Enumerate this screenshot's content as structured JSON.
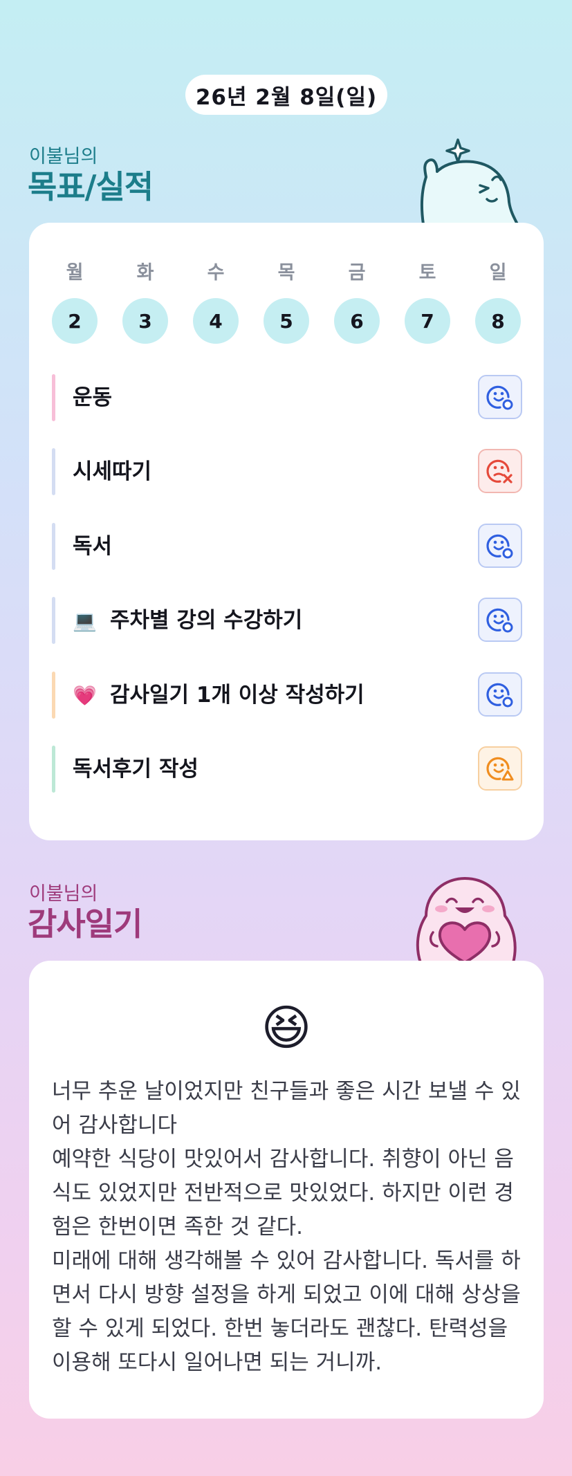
{
  "date": "26년 2월 8일(일)",
  "goals_section": {
    "subtitle": "이불님의",
    "title": "목표/실적",
    "days": [
      {
        "label": "월",
        "num": "2"
      },
      {
        "label": "화",
        "num": "3"
      },
      {
        "label": "수",
        "num": "4"
      },
      {
        "label": "목",
        "num": "5"
      },
      {
        "label": "금",
        "num": "6"
      },
      {
        "label": "토",
        "num": "7"
      },
      {
        "label": "일",
        "num": "8"
      }
    ],
    "goals": [
      {
        "emoji": "",
        "text": "운동",
        "bar_color": "#f7bfd8",
        "status": "done"
      },
      {
        "emoji": "",
        "text": "시세따기",
        "bar_color": "#d4ddf2",
        "status": "failed"
      },
      {
        "emoji": "",
        "text": "독서",
        "bar_color": "#d4ddf2",
        "status": "done"
      },
      {
        "emoji": "💻",
        "text": "주차별 강의 수강하기",
        "bar_color": "#d4ddf2",
        "status": "done"
      },
      {
        "emoji": "💗",
        "text": "감사일기 1개 이상 작성하기",
        "bar_color": "#fbd9b3",
        "status": "done"
      },
      {
        "emoji": "",
        "text": "독서후기 작성",
        "bar_color": "#bde8d6",
        "status": "partial"
      }
    ],
    "status_colors": {
      "done": "#2f5fe0",
      "failed": "#e5493a",
      "partial": "#f08d1f"
    }
  },
  "gratitude_section": {
    "subtitle": "이불님의",
    "title": "감사일기",
    "mood_emoji": "😆",
    "paragraphs": [
      "너무 추운 날이었지만 친구들과 좋은 시간 보낼 수 있어 감사합니다",
      "예약한 식당이 맛있어서 감사합니다. 취향이 아닌 음식도 있었지만 전반적으로 맛있었다. 하지만 이런 경험은 한번이면 족한 것 같다.",
      "미래에 대해 생각해볼 수 있어 감사합니다. 독서를 하면서 다시 방향 설정을 하게 되었고 이에 대해 상상을 할 수 있게 되었다. 한번 놓더라도 괜찮다. 탄력성을 이용해 또다시 일어나면 되는 거니까."
    ]
  }
}
